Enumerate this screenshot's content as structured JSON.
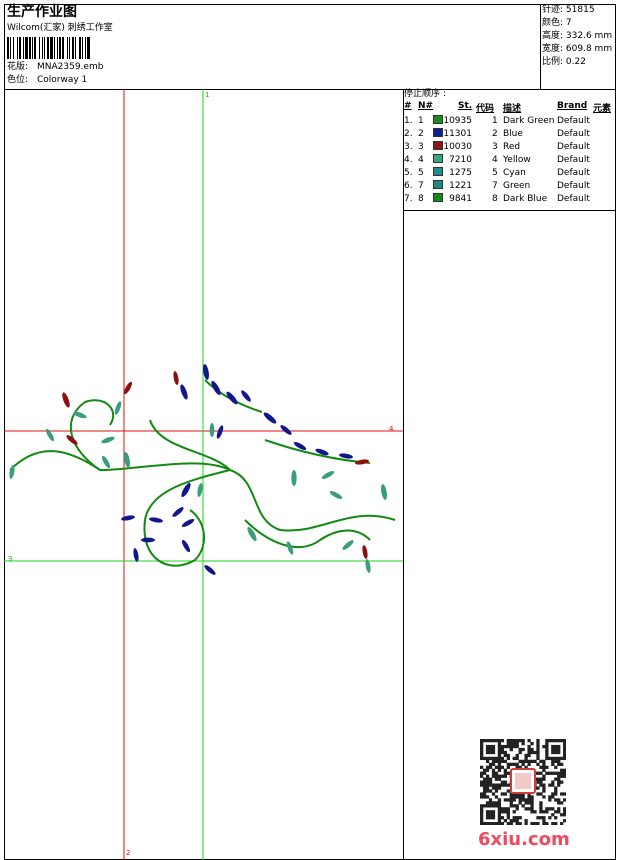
{
  "header": {
    "title": "生产作业图",
    "studio": "Wilcom(汇家) 刺绣工作室",
    "design_label": "花版:",
    "design_value": "MNA2359.emb",
    "colorway_label": "色位:",
    "colorway_value": "Colorway 1"
  },
  "stats": [
    {
      "label": "针迹:",
      "value": "51815"
    },
    {
      "label": "颜色:",
      "value": "7"
    },
    {
      "label": "高度:",
      "value": "332.6 mm"
    },
    {
      "label": "宽度:",
      "value": "609.8 mm"
    },
    {
      "label": "比例:",
      "value": "0.22"
    }
  ],
  "stop_sequence": {
    "title": "停止顺序 :",
    "columns": [
      "#",
      "N#",
      "St.",
      "代码",
      "描述",
      "Brand",
      "元素"
    ],
    "rows": [
      {
        "idx": "1.",
        "n": "1",
        "color": "#1a8a1a",
        "st": "10935",
        "code": "1",
        "desc": "Dark Green",
        "brand": "Default"
      },
      {
        "idx": "2.",
        "n": "2",
        "color": "#131c8c",
        "st": "11301",
        "code": "2",
        "desc": "Blue",
        "brand": "Default"
      },
      {
        "idx": "3.",
        "n": "3",
        "color": "#8c1414",
        "st": "10030",
        "code": "3",
        "desc": "Red",
        "brand": "Default"
      },
      {
        "idx": "4.",
        "n": "4",
        "color": "#3aa67a",
        "st": "7210",
        "code": "4",
        "desc": "Yellow",
        "brand": "Default"
      },
      {
        "idx": "5.",
        "n": "5",
        "color": "#1e8c8c",
        "st": "1275",
        "code": "5",
        "desc": "Cyan",
        "brand": "Default"
      },
      {
        "idx": "6.",
        "n": "7",
        "color": "#22877f",
        "st": "1221",
        "code": "7",
        "desc": "Green",
        "brand": "Default"
      },
      {
        "idx": "7.",
        "n": "8",
        "color": "#148a1e",
        "st": "9841",
        "code": "8",
        "desc": "Dark Blue",
        "brand": "Default"
      }
    ]
  },
  "canvas": {
    "marker_top": "1",
    "marker_right": "4",
    "marker_left": "3",
    "marker_bottom": "2"
  },
  "watermark": {
    "site": "6xiu.com",
    "seal_text": "六秀"
  },
  "colors": {
    "stem": "#128a12",
    "leaf_blue": "#12168c",
    "leaf_red": "#8c1010",
    "leaf_teal": "#3a9e7e",
    "guide_red": "#e01010",
    "guide_green": "#18d418"
  }
}
